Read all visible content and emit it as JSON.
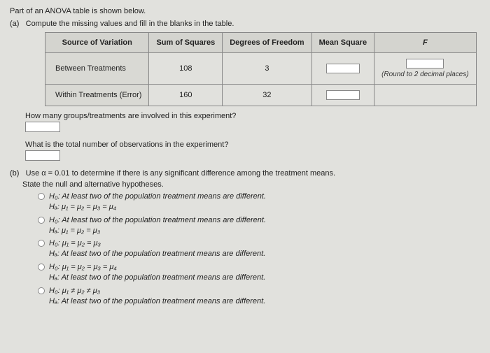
{
  "intro": "Part of an ANOVA table is shown below.",
  "partA": {
    "label": "(a)",
    "instruction": "Compute the missing values and fill in the blanks in the table.",
    "table": {
      "headers": {
        "source": "Source of Variation",
        "ss": "Sum of Squares",
        "df": "Degrees of Freedom",
        "ms": "Mean Square",
        "f": "F"
      },
      "rows": {
        "between": {
          "source": "Between Treatments",
          "ss": "108",
          "df": "3"
        },
        "within": {
          "source": "Within Treatments (Error)",
          "ss": "160",
          "df": "32"
        }
      },
      "round_note": "(Round to 2 decimal places)"
    },
    "q_groups": "How many groups/treatments are involved in this experiment?",
    "q_total": "What is the total number of observations in the experiment?"
  },
  "partB": {
    "label": "(b)",
    "intro_pre": "Use α = ",
    "alpha": "0.01",
    "intro_post": " to determine if there is any significant difference among the treatment means.",
    "state": "State the null and alternative hypotheses.",
    "options": {
      "o1": {
        "h0": "H₀: At least two of the population treatment means are different.",
        "ha": "Hₐ: μ₁ = μ₂ = μ₃ = μ₄"
      },
      "o2": {
        "h0": "H₀: At least two of the population treatment means are different.",
        "ha": "Hₐ: μ₁ = μ₂ = μ₃"
      },
      "o3": {
        "h0": "H₀: μ₁ = μ₂ = μ₃",
        "ha": "Hₐ: At least two of the population treatment means are different."
      },
      "o4": {
        "h0": "H₀: μ₁ = μ₂ = μ₃ = μ₄",
        "ha": "Hₐ: At least two of the population treatment means are different."
      },
      "o5": {
        "h0": "H₀: μ₁ ≠ μ₂ ≠ μ₃",
        "ha": "Hₐ: At least two of the population treatment means are different."
      }
    }
  }
}
